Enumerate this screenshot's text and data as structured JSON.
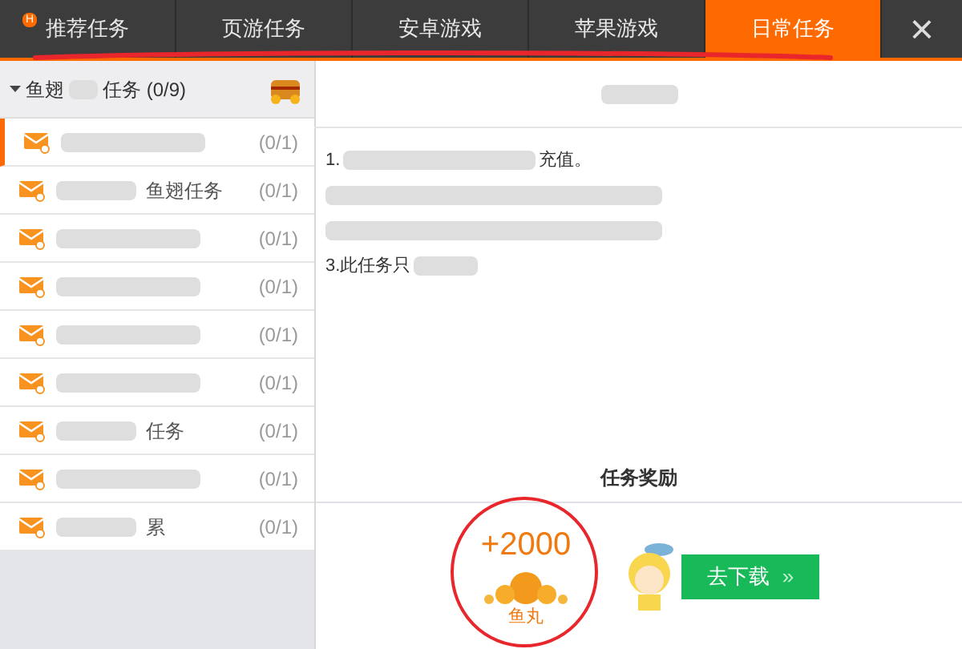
{
  "tabs": [
    {
      "label": "推荐任务",
      "selected": false,
      "badge": "H"
    },
    {
      "label": "页游任务",
      "selected": false
    },
    {
      "label": "安卓游戏",
      "selected": false
    },
    {
      "label": "苹果游戏",
      "selected": false
    },
    {
      "label": "日常任务",
      "selected": true
    }
  ],
  "close": "×",
  "group": {
    "name": "鱼翅",
    "suffix": "任务 (0/9)",
    "expanded": true
  },
  "tasks": [
    {
      "selected": true,
      "count": "(0/1)"
    },
    {
      "selected": false,
      "text": "鱼翅任务",
      "count": "(0/1)"
    },
    {
      "selected": false,
      "count": "(0/1)"
    },
    {
      "selected": false,
      "count": "(0/1)"
    },
    {
      "selected": false,
      "count": "(0/1)"
    },
    {
      "selected": false,
      "count": "(0/1)"
    },
    {
      "selected": false,
      "text": "任务",
      "count": "(0/1)"
    },
    {
      "selected": false,
      "count": "(0/1)"
    },
    {
      "selected": false,
      "text": "累",
      "count": "(0/1)"
    }
  ],
  "detail": {
    "lines": [
      {
        "kind": "text",
        "text": "1.",
        "tail": "充值。"
      },
      {
        "kind": "redacted"
      },
      {
        "kind": "redacted"
      },
      {
        "kind": "text",
        "text": "3.此任务只"
      }
    ]
  },
  "reward": {
    "heading": "任务奖励",
    "amount": "+2000",
    "unit": "鱼丸",
    "button": "去下载",
    "button_icon": "»"
  }
}
